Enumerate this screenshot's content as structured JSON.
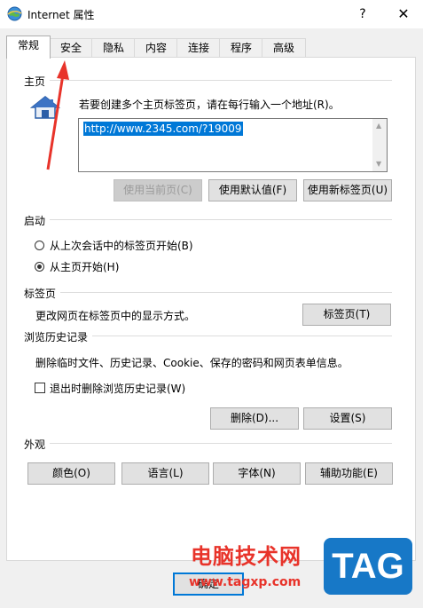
{
  "window": {
    "title": "Internet 属性",
    "help": "?",
    "close": "✕"
  },
  "tabs": [
    "常规",
    "安全",
    "隐私",
    "内容",
    "连接",
    "程序",
    "高级"
  ],
  "homepage": {
    "section": "主页",
    "instruction": "若要创建多个主页标签页，请在每行输入一个地址(R)。",
    "url": "http://www.2345.com/?19009",
    "buttons": {
      "use_current": "使用当前页(C)",
      "use_default": "使用默认值(F)",
      "use_new_tab": "使用新标签页(U)"
    }
  },
  "startup": {
    "section": "启动",
    "option_last_session": "从上次会话中的标签页开始(B)",
    "option_home": "从主页开始(H)",
    "selected": "option_home"
  },
  "tabs_section": {
    "section": "标签页",
    "description": "更改网页在标签页中的显示方式。",
    "button": "标签页(T)"
  },
  "history": {
    "section": "浏览历史记录",
    "description": "删除临时文件、历史记录、Cookie、保存的密码和网页表单信息。",
    "checkbox": "退出时删除浏览历史记录(W)",
    "checked": false,
    "delete_button": "删除(D)...",
    "settings_button": "设置(S)"
  },
  "appearance": {
    "section": "外观",
    "colors": "颜色(O)",
    "languages": "语言(L)",
    "fonts": "字体(N)",
    "accessibility": "辅助功能(E)"
  },
  "footer": {
    "ok": "确定"
  },
  "watermark": {
    "site_name": "电脑技术网",
    "site_url": "www.tagxp.com",
    "badge": "TAG"
  },
  "colors": {
    "accent": "#0078d7",
    "watermark_red": "#e8332a",
    "badge_blue": "#1778c7"
  }
}
